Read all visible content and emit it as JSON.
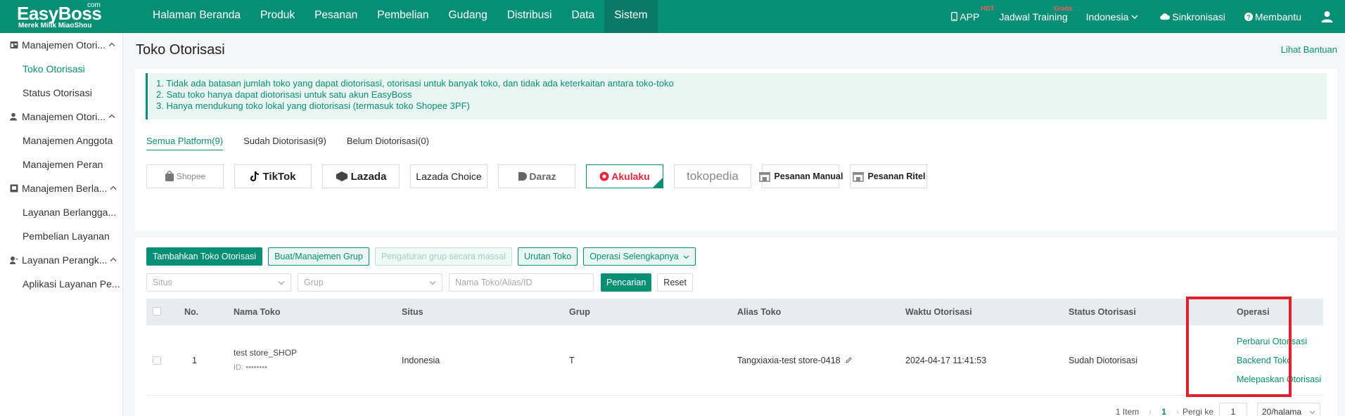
{
  "brand": {
    "name": "EasyBoss",
    "com": "com",
    "tagline": "Merek Milik MiaoShou"
  },
  "nav": [
    "Halaman Beranda",
    "Produk",
    "Pesanan",
    "Pembelian",
    "Gudang",
    "Distribusi",
    "Data",
    "Sistem"
  ],
  "nav_active": "Sistem",
  "right_nav": {
    "app": "APP",
    "app_badge": "HOT",
    "training": "Jadwal Training",
    "training_badge": "Gratis",
    "language": "Indonesia",
    "sync": "Sinkronisasi",
    "help": "Membantu"
  },
  "sidebar": {
    "groups": [
      {
        "label": "Manajemen Otori...",
        "icon": "store-icon",
        "items": [
          "Toko Otorisasi",
          "Status Otorisasi"
        ]
      },
      {
        "label": "Manajemen Otori...",
        "icon": "user-icon",
        "items": [
          "Manajemen Anggota",
          "Manajemen Peran"
        ]
      },
      {
        "label": "Manajemen Berla...",
        "icon": "subscription-icon",
        "items": [
          "Layanan Berlangga...",
          "Pembelian Layanan"
        ]
      },
      {
        "label": "Layanan Perangk...",
        "icon": "service-icon",
        "items": [
          "Aplikasi Layanan Pe..."
        ]
      }
    ],
    "active_item": "Toko Otorisasi"
  },
  "page": {
    "title": "Toko Otorisasi",
    "help_link": "Lihat Bantuan",
    "notice": [
      "1. Tidak ada batasan jumlah toko yang dapat diotorisasi, otorisasi untuk banyak toko, dan tidak ada keterkaitan antara toko-toko",
      "2. Satu toko hanya dapat diotorisasi untuk satu akun EasyBoss",
      "3. Hanya mendukung toko lokal yang diotorisasi (termasuk toko Shopee 3PF)"
    ],
    "tabs": [
      "Semua Platform(9)",
      "Sudah Diotorisasi(9)",
      "Belum Diotorisasi(0)"
    ],
    "active_tab": 0,
    "platforms": [
      "Shopee",
      "TikTok",
      "Lazada",
      "Lazada Choice",
      "Daraz",
      "Akulaku",
      "tokopedia",
      "Pesanan Manual",
      "Pesanan Ritel"
    ],
    "selected_platform": "Akulaku",
    "actions": {
      "add": "Tambahkan Toko Otorisasi",
      "group": "Buat/Manajemen Grup",
      "bulk_group": "Pengaturan grup secara massal",
      "order": "Urutan Toko",
      "more": "Operasi Selengkapnya"
    },
    "filters": {
      "site_placeholder": "Situs",
      "group_placeholder": "Grup",
      "search_placeholder": "Nama Toko/Alias/ID",
      "search_btn": "Pencarian",
      "reset_btn": "Reset"
    },
    "table": {
      "columns": [
        "No.",
        "Nama Toko",
        "Situs",
        "Grup",
        "Alias Toko",
        "Waktu Otorisasi",
        "Status Otorisasi",
        "Operasi"
      ],
      "rows": [
        {
          "no": "1",
          "name": "test store_SHOP",
          "id": "ID: ••••••••",
          "site": "Indonesia",
          "group": "T",
          "alias": "Tangxiaxia-test store-0418",
          "time": "2024-04-17 11:41:53",
          "status": "Sudah Diotorisasi",
          "ops": [
            "Perbarui Otorisasi",
            "Backend Toko",
            "Melepaskan Otorisasi"
          ]
        }
      ]
    },
    "pagination": {
      "total": "1 Item",
      "current": "1",
      "goto_label": "Pergi ke",
      "goto_value": "1",
      "page_size": "20/halama"
    }
  },
  "colors": {
    "primary": "#078f76",
    "highlight": "#e0202a"
  }
}
